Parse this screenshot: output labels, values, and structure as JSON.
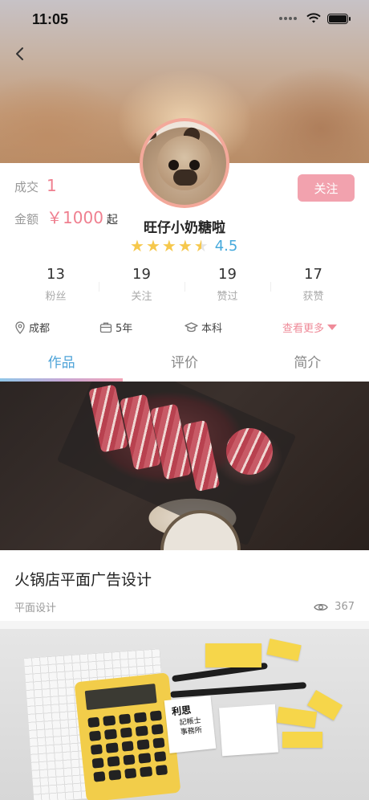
{
  "status_bar": {
    "time": "11:05"
  },
  "header": {
    "back_icon": "chevron-left-icon"
  },
  "profile": {
    "deal_label": "成交",
    "deal_value": "1",
    "amount_label": "金额",
    "amount_value": "￥1000",
    "amount_suffix": "起",
    "follow_label": "关注",
    "name": "旺仔小奶糖啦",
    "rating": "4.5",
    "rating_stars": 4.5
  },
  "counts": [
    {
      "value": "13",
      "label": "粉丝"
    },
    {
      "value": "19",
      "label": "关注"
    },
    {
      "value": "19",
      "label": "赞过"
    },
    {
      "value": "17",
      "label": "获赞"
    }
  ],
  "info": {
    "location": "成都",
    "years": "5年",
    "education": "本科",
    "more": "查看更多"
  },
  "tabs": [
    {
      "label": "作品",
      "active": true
    },
    {
      "label": "评价",
      "active": false
    },
    {
      "label": "简介",
      "active": false
    }
  ],
  "works": [
    {
      "title": "火锅店平面广告设计",
      "category": "平面设计",
      "views": "367"
    }
  ],
  "work2_card": {
    "title": "利思",
    "subtitle": "記帳士 事務所"
  },
  "colors": {
    "accent_blue": "#4fa4d8",
    "accent_pink": "#ef7f8f",
    "star": "#f6c84c"
  }
}
